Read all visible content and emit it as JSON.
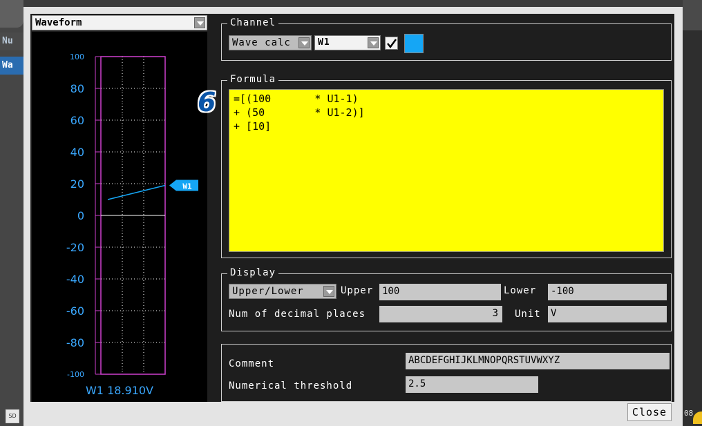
{
  "sidebar": {
    "tabs": [
      {
        "label": "Nu"
      },
      {
        "label": "Wa"
      }
    ],
    "sd_label": "SD"
  },
  "status_right": {
    "text": "08"
  },
  "waveform_panel": {
    "selector_value": "Waveform",
    "readout": "W1 18.910V",
    "marker_label": "W1",
    "chart_data": {
      "type": "line",
      "y_tick_labels": [
        "100",
        "80",
        "60",
        "40",
        "20",
        "0",
        "-20",
        "-40",
        "-60",
        "-80",
        "-100"
      ],
      "ylim": [
        -100,
        100
      ],
      "grid": true,
      "series": [
        {
          "name": "W1",
          "color": "#15a6f5",
          "start_value": 10,
          "end_value": 18.91
        }
      ],
      "marker_value": 18.91
    }
  },
  "channel": {
    "title": "Channel",
    "type_value": "Wave calc",
    "channel_value": "W1",
    "enabled": true,
    "color": "#15a6f5"
  },
  "formula": {
    "title": "Formula",
    "lines": [
      "=[(100       * U1-1)",
      "+ (50        * U1-2)]",
      "+ [10]"
    ],
    "step_badge": "6"
  },
  "display": {
    "title": "Display",
    "mode_value": "Upper/Lower",
    "upper_label": "Upper",
    "upper_value": "100",
    "lower_label": "Lower",
    "lower_value": "-100",
    "decimal_label": "Num of decimal places",
    "decimal_value": "3",
    "unit_label": "Unit",
    "unit_value": "V"
  },
  "comment_group": {
    "comment_label": "Comment",
    "comment_value": "ABCDEFGHIJKLMNOPQRSTUVWXYZ",
    "threshold_label": "Numerical threshold",
    "threshold_value": "2.5"
  },
  "buttons": {
    "close_label": "Close"
  }
}
